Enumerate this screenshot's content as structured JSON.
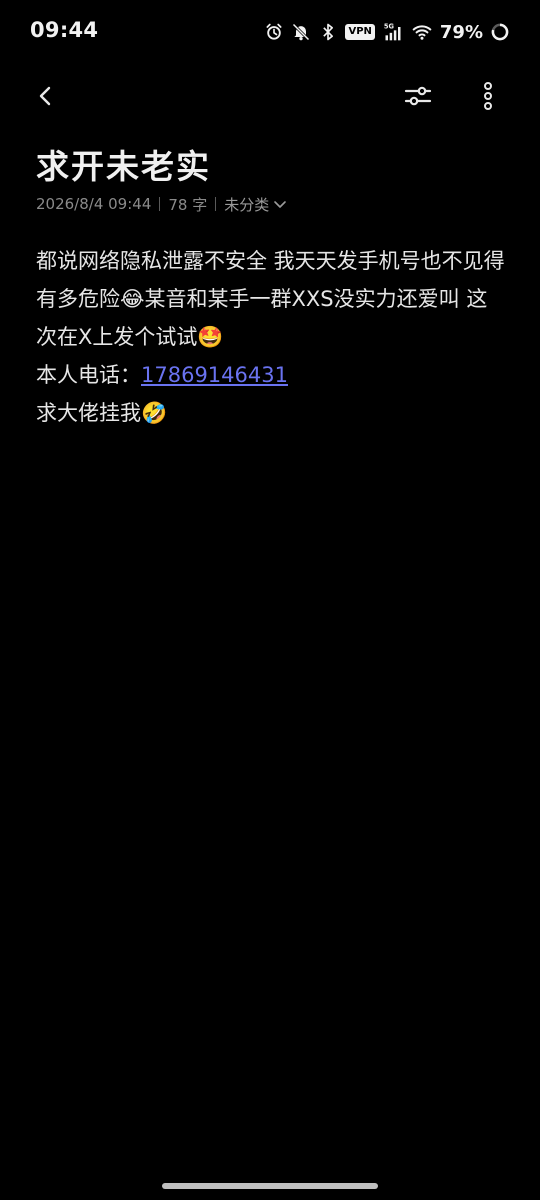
{
  "status_bar": {
    "time": "09:44",
    "vpn": "VPN",
    "network": "5G",
    "battery_percent": "79%",
    "icons": [
      "alarm-icon",
      "mute-bell-icon",
      "bluetooth-icon",
      "vpn-icon",
      "cell-signal-icon",
      "wifi-icon",
      "battery-ring-icon"
    ]
  },
  "toolbar": {
    "icons": [
      "back-chevron-icon",
      "format-sliders-icon",
      "more-vertical-icon"
    ]
  },
  "note": {
    "title": "求开未老实",
    "date": "2026/8/4 09:44",
    "word_count": "78 字",
    "category": "未分类",
    "body": {
      "paragraph1": "都说网络隐私泄露不安全 我天天发手机号也不见得有多危险😂某音和某手一群XXS没实力还爱叫 这次在X上发个试试🤩",
      "phone_label": "本人电话：",
      "phone_number": "17869146431",
      "closing": "求大佬挂我🤣"
    }
  },
  "colors": {
    "background": "#000000",
    "text": "#e6e6e6",
    "meta": "#8a8a8a",
    "link": "#6a73f0"
  }
}
